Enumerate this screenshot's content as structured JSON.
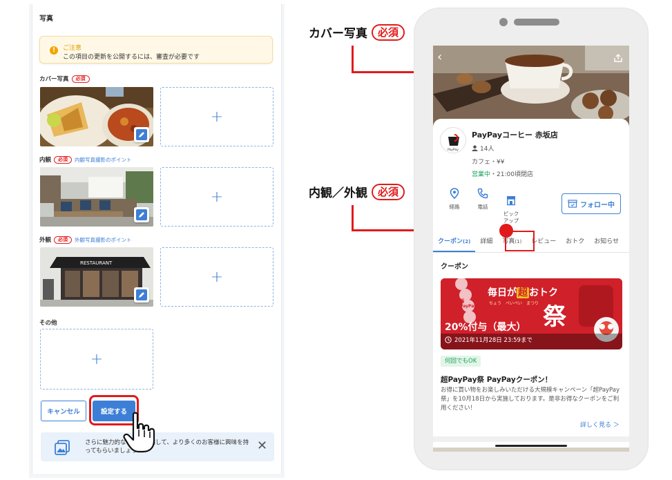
{
  "editor": {
    "section_title": "写真",
    "notice": {
      "title": "ご注意",
      "text": "この項目の更新を公開するには、審査が必要です"
    },
    "cover": {
      "label": "カバー写真",
      "required": "必須"
    },
    "interior": {
      "label": "内観",
      "required": "必須",
      "hint": "内観写真撮影のポイント"
    },
    "exterior": {
      "label": "外観",
      "required": "必須",
      "hint": "外観写真撮影のポイント"
    },
    "other": {
      "label": "その他"
    },
    "add_symbol": "+",
    "exterior_sign": "RESTAURANT",
    "cancel_label": "キャンセル",
    "save_label": "設定する",
    "tip": {
      "text": "さらに魅力的な写真を追加して、より多くのお客様に興味を持ってもらいましょう",
      "close": "✕"
    }
  },
  "callouts": {
    "cover": {
      "label": "カバー写真",
      "required": "必須"
    },
    "interior_exterior": {
      "label": "内観／外観",
      "required": "必須"
    }
  },
  "phone": {
    "back": "‹",
    "shop": {
      "name": "PayPayコーヒー 赤坂店",
      "followers": "14人",
      "category": "カフェ・¥¥",
      "status": "営業中",
      "hours": "・21:00頃閉店",
      "logo_text": "PayPay"
    },
    "actions": [
      {
        "label": "経路",
        "icon": "pin-icon"
      },
      {
        "label": "電話",
        "icon": "phone-icon"
      },
      {
        "label": "ピック\nアップ",
        "icon": "store-icon"
      }
    ],
    "follow_label": "フォロー中",
    "tabs": [
      {
        "label": "クーポン",
        "count": "(2)"
      },
      {
        "label": "詳細",
        "count": ""
      },
      {
        "label": "写真",
        "count": "(1)"
      },
      {
        "label": "レビュー",
        "count": ""
      },
      {
        "label": "おトク",
        "count": ""
      },
      {
        "label": "お知らせ",
        "count": ""
      }
    ],
    "coupon_heading": "クーポン",
    "coupon": {
      "banner_top": "毎日が",
      "banner_highlight": "超",
      "banner_end": "おトク",
      "furigana": "ちょう　ぺいぺい　まつり",
      "festival": "祭",
      "badge_left": "超PayPay",
      "percent": "20%付与（最大）",
      "date": "2021年11月28日 23:59まで",
      "repeat_badge": "何回でもOK",
      "title": "超PayPay祭 PayPayクーポン！",
      "desc": "お得に買い物をお楽しみいただける大規模キャンペーン「超PayPay祭」を10月18日から実施しております。是非お得なクーポンをご利用ください！",
      "more": "詳しく見る ＞"
    }
  }
}
